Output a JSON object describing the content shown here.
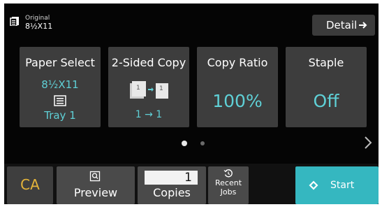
{
  "header": {
    "original_title": "Original",
    "original_size": "8½X11",
    "detail_label": "Detail"
  },
  "tiles": {
    "paper_select": {
      "title": "Paper Select",
      "size": "8½X11",
      "tray": "Tray 1"
    },
    "two_sided": {
      "title": "2-Sided Copy",
      "mode": "1 → 1"
    },
    "copy_ratio": {
      "title": "Copy Ratio",
      "value": "100%"
    },
    "staple": {
      "title": "Staple",
      "value": "Off"
    }
  },
  "pager": {
    "current_page": 1,
    "total_pages": 2
  },
  "bottom": {
    "ca_label": "CA",
    "preview_label": "Preview",
    "copies_value": "1",
    "copies_label": "Copies",
    "recent_line1": "Recent",
    "recent_line2": "Jobs",
    "start_label": "Start"
  },
  "colors": {
    "accent_value": "#5fd0d6",
    "start": "#35b7c0",
    "ca": "#e4b43a",
    "tile_bg": "#3d3d3d",
    "screen_bg": "#050505"
  },
  "icons": {
    "original": "document-stack-icon",
    "detail": "arrow-right-icon",
    "paper": "paper-tray-icon",
    "duplex": "duplex-pages-icon",
    "next": "chevron-right-icon",
    "preview": "preview-magnifier-icon",
    "recent": "history-icon",
    "start": "start-diamond-icon"
  }
}
